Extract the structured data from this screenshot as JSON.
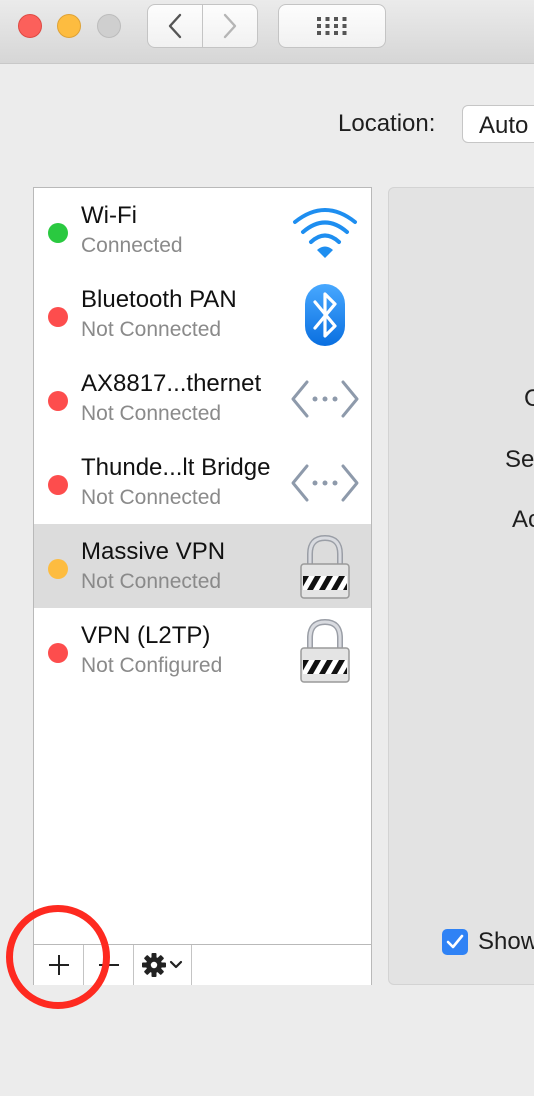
{
  "window": {
    "traffic_lights": [
      "close",
      "minimize",
      "zoom"
    ],
    "toolbar": {
      "back_icon": "chevron-left-icon",
      "forward_icon": "chevron-right-icon",
      "show_all_icon": "grid-icon"
    }
  },
  "location": {
    "label": "Location:",
    "value": "Auto"
  },
  "services": [
    {
      "name": "Wi-Fi",
      "status": "Connected",
      "status_color": "#2ac940",
      "icon": "wifi-icon"
    },
    {
      "name": "Bluetooth PAN",
      "status": "Not Connected",
      "status_color": "#fd4d4d",
      "icon": "bluetooth-icon"
    },
    {
      "name": "AX8817...thernet",
      "status": "Not Connected",
      "status_color": "#fd4d4d",
      "icon": "ethernet-icon"
    },
    {
      "name": "Thunde...lt Bridge",
      "status": "Not Connected",
      "status_color": "#fd4d4d",
      "icon": "ethernet-icon"
    },
    {
      "name": "Massive VPN",
      "status": "Not Connected",
      "status_color": "#fdbc40",
      "icon": "vpn-lock-icon",
      "selected": true
    },
    {
      "name": "VPN (L2TP)",
      "status": "Not Configured",
      "status_color": "#fd4d4d",
      "icon": "vpn-lock-icon"
    }
  ],
  "list_toolbar": {
    "add": "+",
    "remove": "−",
    "gear_icon": "gear-icon"
  },
  "detail": {
    "labels": [
      "C",
      "Se",
      "Ac"
    ],
    "show_checkbox_checked": true,
    "show_label": "Show"
  },
  "annotation": {
    "color": "#fe2a20",
    "target": "add-service-button"
  }
}
